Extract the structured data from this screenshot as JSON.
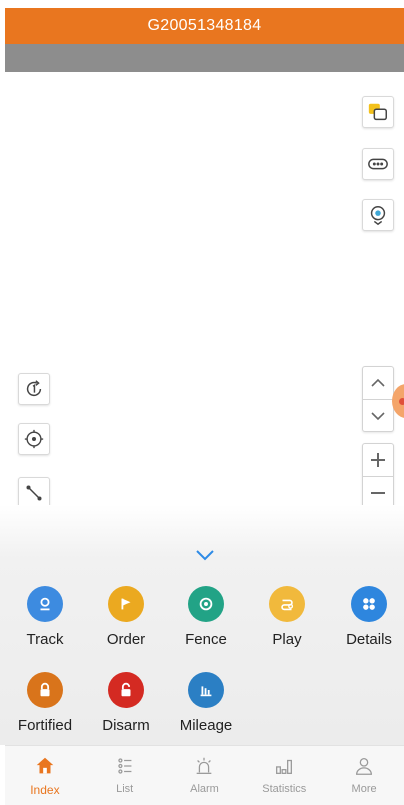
{
  "header": {
    "title": "G20051348184"
  },
  "functions": [
    {
      "label": "Track",
      "icon": "track-pin-icon",
      "color": "#3d8be0"
    },
    {
      "label": "Order",
      "icon": "flag-icon",
      "color": "#eba920"
    },
    {
      "label": "Fence",
      "icon": "fence-target-icon",
      "color": "#22a386"
    },
    {
      "label": "Play",
      "icon": "play-route-icon",
      "color": "#f1b93c"
    },
    {
      "label": "Details",
      "icon": "details-grid-icon",
      "color": "#2e86de"
    },
    {
      "label": "Fortified",
      "icon": "lock-closed-icon",
      "color": "#d9741b"
    },
    {
      "label": "Disarm",
      "icon": "lock-open-icon",
      "color": "#d42a22"
    },
    {
      "label": "Mileage",
      "icon": "mileage-chart-icon",
      "color": "#2b7fc4"
    }
  ],
  "tabs": [
    {
      "label": "Index",
      "icon": "home-icon",
      "active": true
    },
    {
      "label": "List",
      "icon": "list-icon",
      "active": false
    },
    {
      "label": "Alarm",
      "icon": "alarm-icon",
      "active": false
    },
    {
      "label": "Statistics",
      "icon": "statistics-icon",
      "active": false
    },
    {
      "label": "More",
      "icon": "user-icon",
      "active": false
    }
  ],
  "colors": {
    "accent": "#e9761f",
    "subbar": "#8d8d8d",
    "inactive": "#9a9a9a"
  }
}
